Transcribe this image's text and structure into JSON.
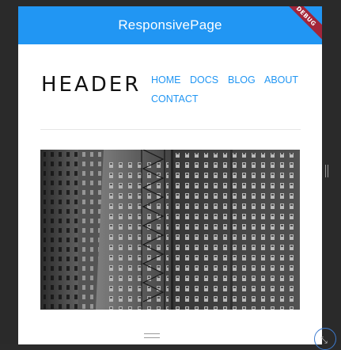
{
  "app_bar": {
    "title": "ResponsivePage",
    "debug_banner": "DEBUG",
    "color": "#2196f3"
  },
  "page": {
    "logo_text": "HEADER",
    "nav": {
      "items": [
        "HOME",
        "DOCS",
        "BLOG",
        "ABOUT",
        "CONTACT"
      ],
      "link_color": "#2196f3"
    }
  },
  "hero": {
    "icon": "building-photo"
  },
  "window": {
    "resize_icon": "resize-icon"
  }
}
